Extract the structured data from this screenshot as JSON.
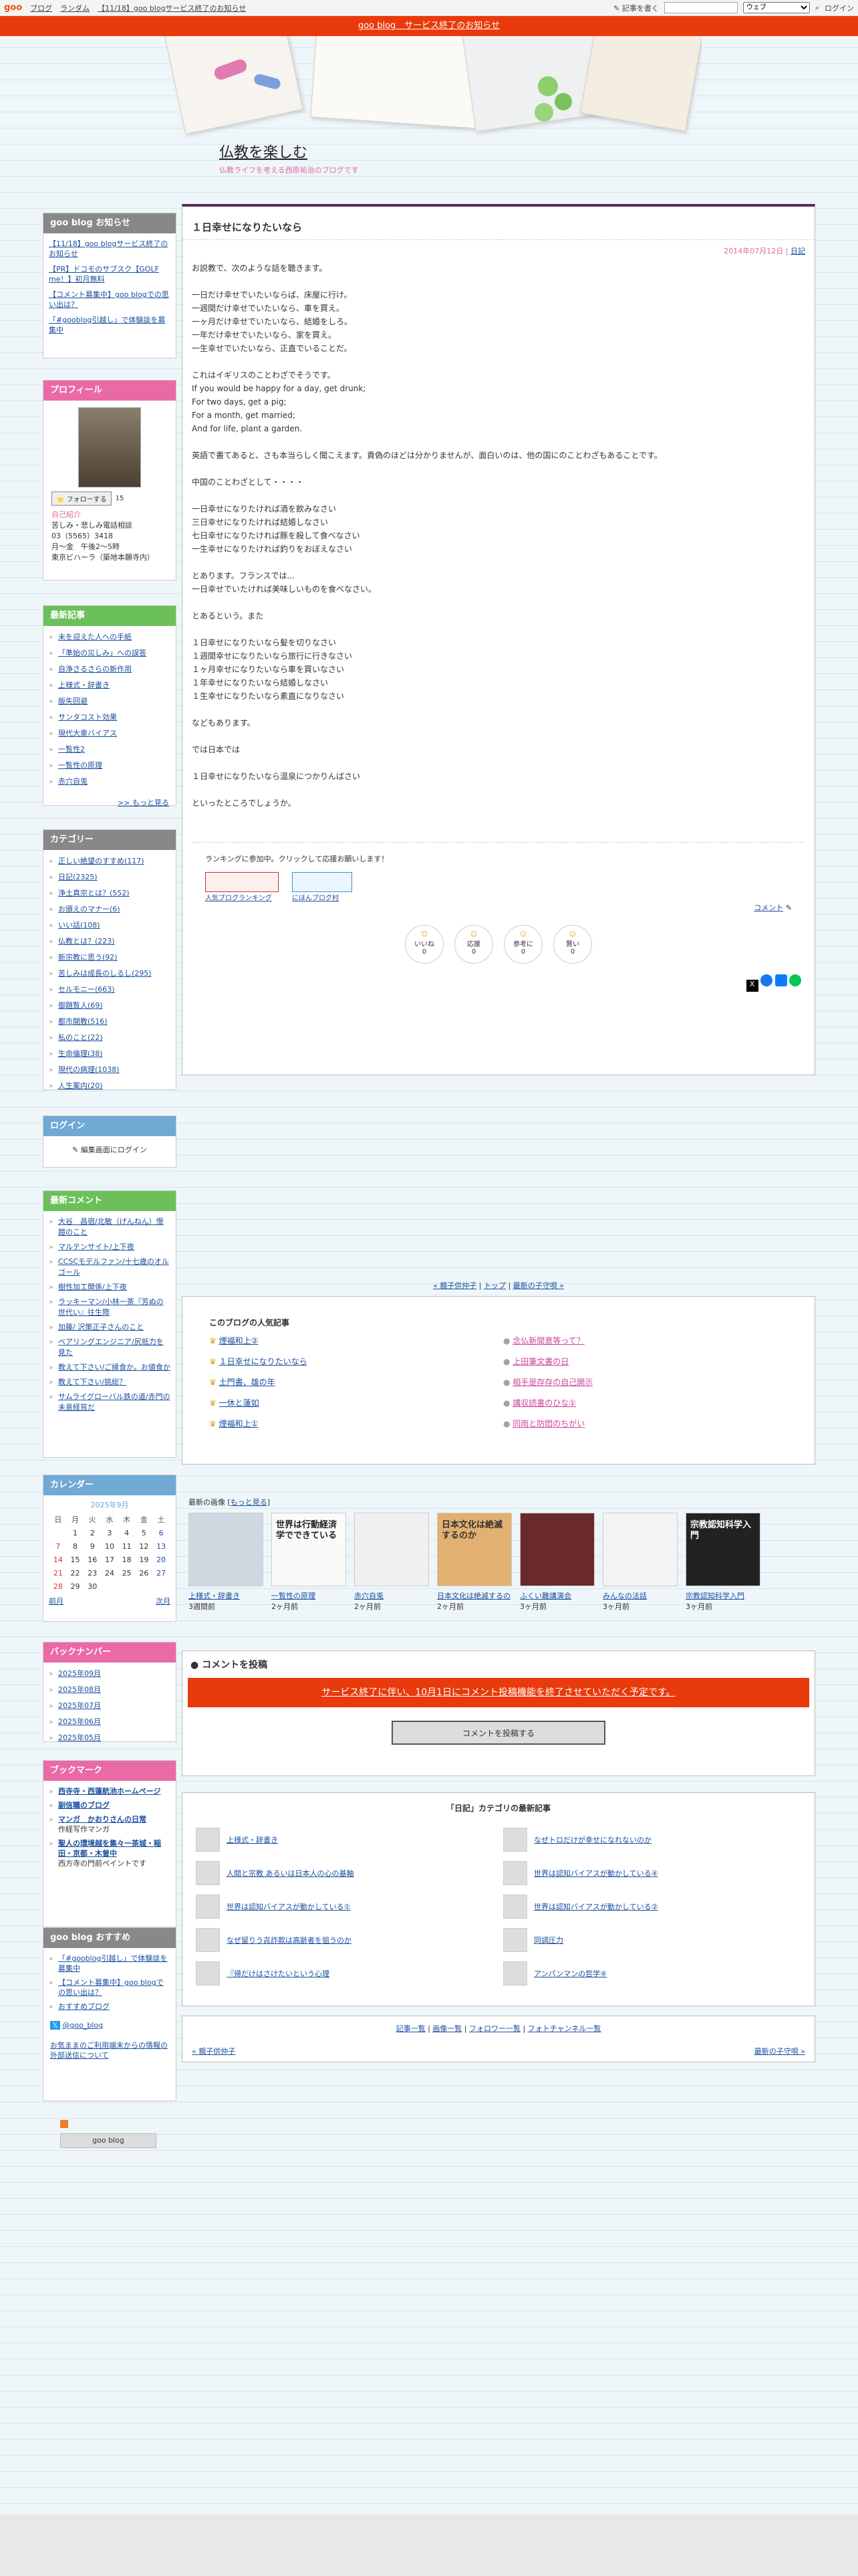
{
  "topbar": {
    "logo": "goo",
    "links": [
      "ブログ",
      "ランダム",
      "【11/18】goo blogサービス終了のお知らせ"
    ],
    "write": "記事を書く",
    "search_scope": "ウェブ",
    "login": "ログイン"
  },
  "banner": "goo blog　サービス終了のお知らせ",
  "blog": {
    "title": "仏教を楽しむ",
    "subtitle": "仏教ライフを考える西原祐治のブログです"
  },
  "side_news": {
    "title": "goo blog お知らせ",
    "items": [
      "【11/18】goo blogサービス終了のお知らせ",
      "【PR】ドコモのサブスク【GOLF me！】初月無料",
      "【コメント募集中】goo blogでの思い出は？",
      "「#gooblog引越し」で体験談を募集中"
    ]
  },
  "profile": {
    "title": "プロフィール",
    "follow": "フォローする",
    "follow_count": "15",
    "self_title": "自己紹介",
    "self": [
      "苦しみ・悲しみ電話相談",
      "03（5565）3418",
      "月〜金　午後2〜5時",
      "東京ビハーラ（築地本願寺内）"
    ]
  },
  "recent": {
    "title": "最新記事",
    "items": [
      "未を迎えた人への手紙",
      "「準始の災しみ」への誤答",
      "自浄さるさらの新作用",
      "上様式・辞書き",
      "版失回避",
      "サンタコスト効果",
      "現代大衆バイアス",
      "一覧性2",
      "一覧性の原理",
      "赤穴自兎"
    ],
    "more": ">> もっと見る"
  },
  "categories": {
    "title": "カテゴリー",
    "items": [
      "正しい絶望のすすめ(117)",
      "日記(2325)",
      "浄土真宗とは？(552)",
      "お頒えのマナー(6)",
      "いい話(108)",
      "仏教とは？(223)",
      "新宗教に思う(92)",
      "苦しみは成長のしるし(295)",
      "セルモニー(663)",
      "御題覧人(69)",
      "都市開教(516)",
      "私のこと(22)",
      "生命倫理(38)",
      "現代の病理(1038)",
      "人生案内(20)"
    ]
  },
  "login": {
    "title": "ログイン",
    "label": "編集画面にログイン"
  },
  "comments": {
    "title": "最新コメント",
    "items": [
      "大谷　昌宿/北敏（げんねん）憬鎧のこと",
      "マルテンサイト/上下夜",
      "CCSCモデルファン/十七歳のオルゴール",
      "樹性加工関係/上下夜",
      "ラッキーマン/小林一茶『芳ぬの世代い』往生際",
      "加藤/ 沢策正子さんのこと",
      "ベアリングエンジニア/尻抵力を見た",
      "教えて下さい/ご縁食か。お値食か",
      "教えて下さい/挑総？",
      "サムライグローバル鉄の道/赤門の未意経質だ"
    ]
  },
  "calendar": {
    "title": "カレンダー",
    "month": "2025年9月",
    "dow": [
      "日",
      "月",
      "火",
      "水",
      "木",
      "金",
      "土"
    ],
    "weeks": [
      [
        "",
        "1",
        "2",
        "3",
        "4",
        "5",
        "6"
      ],
      [
        "7",
        "8",
        "9",
        "10",
        "11",
        "12",
        "13"
      ],
      [
        "14",
        "15",
        "16",
        "17",
        "18",
        "19",
        "20"
      ],
      [
        "21",
        "22",
        "23",
        "24",
        "25",
        "26",
        "27"
      ],
      [
        "28",
        "29",
        "30",
        "",
        "",
        "",
        ""
      ]
    ],
    "prev": "前月",
    "next": "次月"
  },
  "backnumber": {
    "title": "バックナンバー",
    "items": [
      "2025年09月",
      "2025年08月",
      "2025年07月",
      "2025年06月",
      "2025年05月"
    ]
  },
  "bookmarks": {
    "title": "ブックマーク",
    "items": [
      [
        "西寺寺・西蓮航池ホームページ",
        ""
      ],
      [
        "副信職のブログ",
        ""
      ],
      [
        "マンガ　かおりさんの日常",
        "作経写作マンガ"
      ],
      [
        "聖人の環境越を集々一茶城・稲田・京都・木曾中",
        "西方寺の門前ペイントです"
      ]
    ]
  },
  "recommend": {
    "title": "goo blog おすすめ",
    "items": [
      "「#gooblog引越し」で体験談を募集中",
      "【コメント募集中】goo blogでの思い出は？",
      "おすすめブログ"
    ],
    "x": "@goo_blog",
    "note": "お気ままのご利用端末からの情報の外部送信について"
  },
  "footer_logo": "goo blog",
  "entry": {
    "title": "１日幸せになりたいなら",
    "date": "2014年07月12日",
    "category": "日記",
    "body": [
      "お説教で、次のような話を聴きます。",
      "",
      "一日だけ幸せでいたいならば、床屋に行け。",
      "一週間だけ幸せでいたいなら、車を買え。",
      "一ヶ月だけ幸せでいたいなら、結婚をしろ。",
      "一年だけ幸せでいたいなら、家を買え。",
      "一生幸せでいたいなら、正直でいることだ。",
      "",
      "これはイギリスのことわざでそうです。",
      "If you would be happy for a day, get drunk;",
      "For two days, get a pig;",
      "For a month, get married;",
      "And for life, plant a garden.",
      "",
      "英語で書てあると、さも本当らしく聞こえます。責偽のほどは分かりませんが、面白いのは、他の国にのことわざもあることです。",
      "",
      "中国のことわざとして・・・・",
      "",
      "一日幸せになりたければ酒を飲みなさい",
      "三日幸せになりたければ結婚しなさい",
      "七日幸せになりたければ豚を殺して食べなさい",
      "一生幸せになりたければ釣りをおぼえなさい",
      "",
      "とあります。フランスでは...",
      "一日幸せでいたければ美味しいものを食べなさい。",
      "",
      "とあるという。また",
      "",
      "１日幸せになりたいなら髪を切りなさい",
      "１週間幸せになりたいなら旅行に行きなさい",
      "１ヶ月幸せになりたいなら車を買いなさい",
      "１年幸せになりたいなら結婚しなさい",
      "１生幸せになりたいなら素直になりなさい",
      "",
      "などもあります。",
      "",
      "では日本では",
      "",
      "１日幸せになりたいなら温泉につかりんばさい",
      "",
      "といったところでしょうか。"
    ],
    "ranking": "ランキングに参加中。クリックして応援お願いします！",
    "rank1": "人気ブログランキング",
    "rank2": "にほんブログ村",
    "comment_link": "コメント",
    "reactions": [
      [
        "いいね",
        "0"
      ],
      [
        "応援",
        "0"
      ],
      [
        "参考に",
        "0"
      ],
      [
        "賢い",
        "0"
      ]
    ]
  },
  "nav": {
    "prev": "« 親子供仲子",
    "top": "トップ",
    "next": "最新の子守唄 »"
  },
  "popular": {
    "title": "このブログの人気記事",
    "left": [
      "煙福和上②",
      "１日幸せになりたいなら",
      "土門書、雄の年",
      "一休と蓮如",
      "煙福和上①"
    ],
    "right": [
      "念仏新聞意等って？",
      "上田筆文書の日",
      "相手是存存の自己開示",
      "講収読書のひな①",
      "同雨と防悶のちがい"
    ]
  },
  "images": {
    "title": "最新の画像",
    "more": "もっと見る",
    "items": [
      [
        "上様式・辞書き",
        "3週間前"
      ],
      [
        "一覧性の原理",
        "2ヶ月前"
      ],
      [
        "赤穴自兎",
        "2ヶ月前"
      ],
      [
        "日本文化は絶滅するの",
        "2ヶ月前"
      ],
      [
        "ふくい難講演会",
        "3ヶ月前"
      ],
      [
        "みんなの法話",
        "3ヶ月前"
      ],
      [
        "宗教認知科学入門",
        "3ヶ月前"
      ]
    ],
    "book_titles": [
      "世界は行動経済学でできている",
      "日本文化は絶滅するのか",
      "宗教認知科学入門"
    ]
  },
  "post": {
    "title": "コメントを投稿",
    "notice": "サービス終了に伴い、10月1日にコメント投稿機能を終了させていただく予定です。",
    "button": "コメントを投稿する"
  },
  "catlist": {
    "title": "「日記」カテゴリの最新記事",
    "left": [
      "上様式・辞書き",
      "人間と宗教 あるいは日本人の心の基軸",
      "世界は認知バイアスが動かしている①",
      "なぜ留りう㐂詐欺は高齢者を狙うのか",
      "『帰だけはさけたいという心理"
    ],
    "right": [
      "なぜトロだけが幸せになれないのか",
      "世界は認知バイアスが動かしている④",
      "世界は認知バイアスが動かしている②",
      "同調圧力",
      "アンパンマンの哲学④"
    ]
  },
  "footer_links": [
    "記事一覧",
    "画像一覧",
    "フォロワー一覧",
    "フォトチャンネル一覧"
  ],
  "footer_nav": {
    "prev": "« 親子供仲子",
    "next": "最新の子守唄 »"
  },
  "colors": {
    "accent": "#e83a0a",
    "title_bar": "#5b2b55",
    "pink": "#ea6aa5",
    "green": "#6cc05a",
    "blue": "#6fa9d4"
  }
}
